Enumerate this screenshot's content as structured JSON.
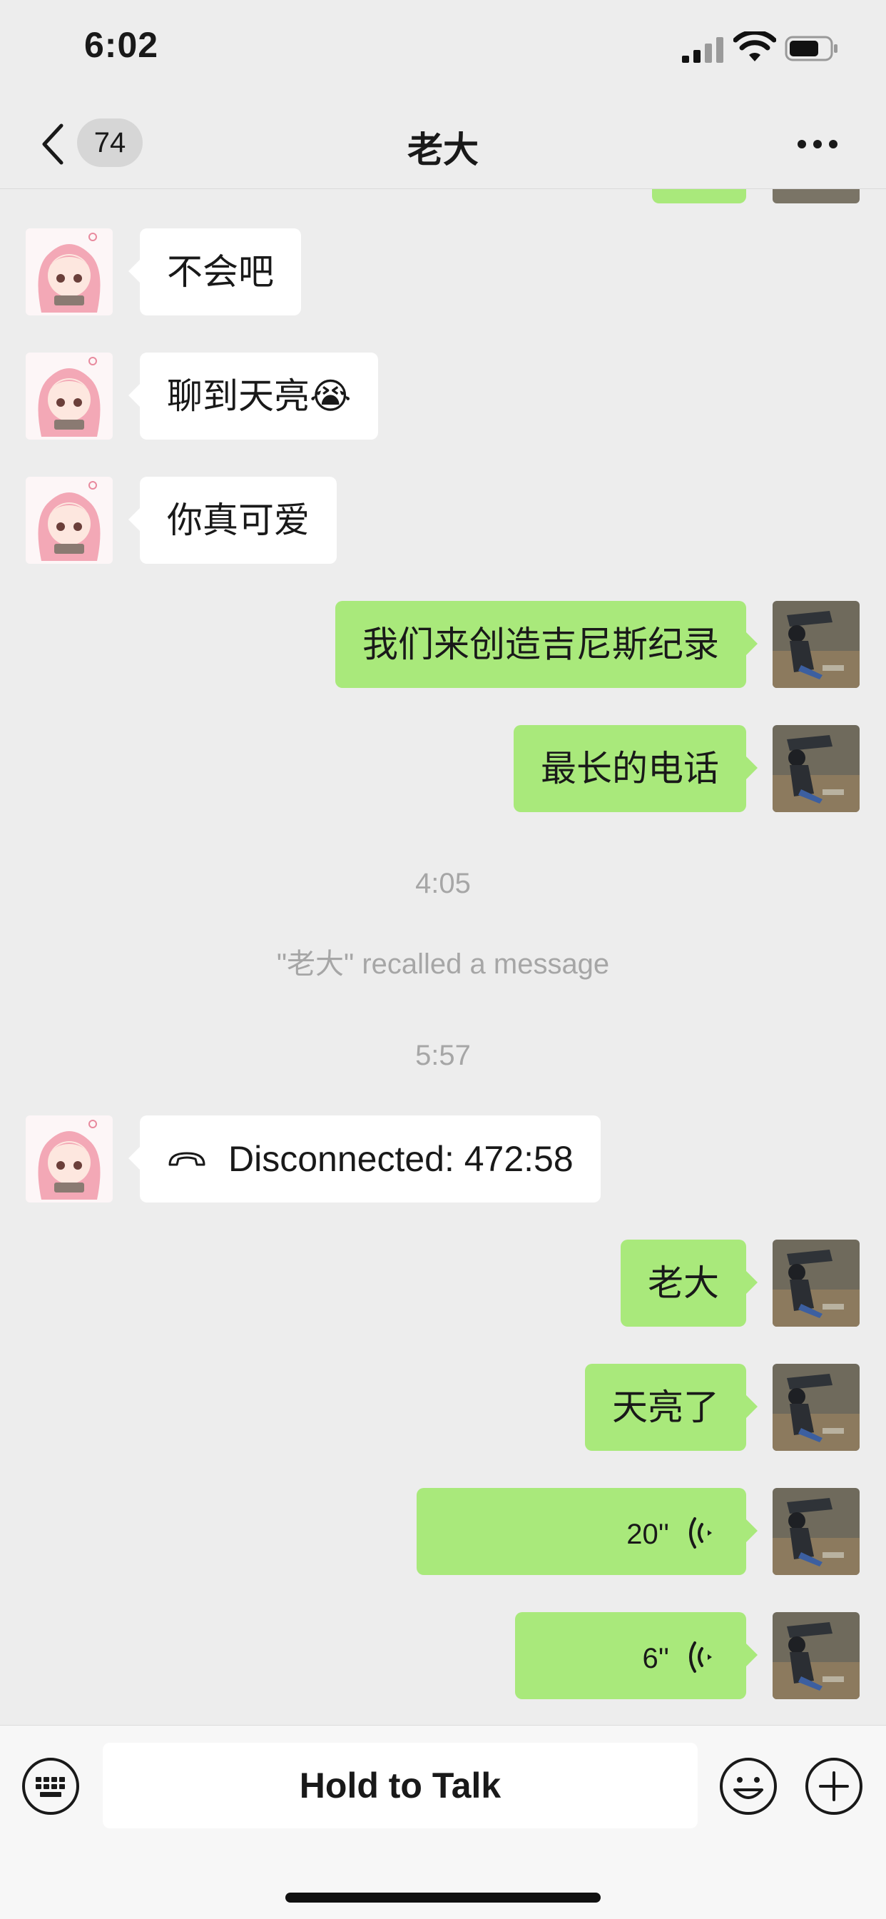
{
  "status_bar": {
    "time": "6:02"
  },
  "nav": {
    "unread_count": "74",
    "title": "老大"
  },
  "messages": [
    {
      "side": "left",
      "text": "不会吧"
    },
    {
      "side": "left",
      "text": "聊到天亮😭"
    },
    {
      "side": "left",
      "text": "你真可爱"
    },
    {
      "side": "right",
      "text": "我们来创造吉尼斯纪录"
    },
    {
      "side": "right",
      "text": "最长的电话"
    }
  ],
  "system": {
    "time1": "4:05",
    "recall": "\"老大\" recalled a message",
    "time2": "5:57"
  },
  "call_message": {
    "text": "Disconnected: 472:58",
    "icon": "phone-hangup-icon"
  },
  "messages2": [
    {
      "side": "right",
      "text": "老大"
    },
    {
      "side": "right",
      "text": "天亮了"
    }
  ],
  "voice_messages": [
    {
      "side": "right",
      "duration": "20''",
      "icon": "voice-wave-icon"
    },
    {
      "side": "right",
      "duration": "6''",
      "icon": "voice-wave-icon"
    }
  ],
  "input_bar": {
    "hold_to_talk": "Hold to Talk"
  },
  "colors": {
    "background": "#ededed",
    "sent_bubble": "#a9e97b",
    "received_bubble": "#ffffff",
    "system_text": "#a6a6a6"
  }
}
